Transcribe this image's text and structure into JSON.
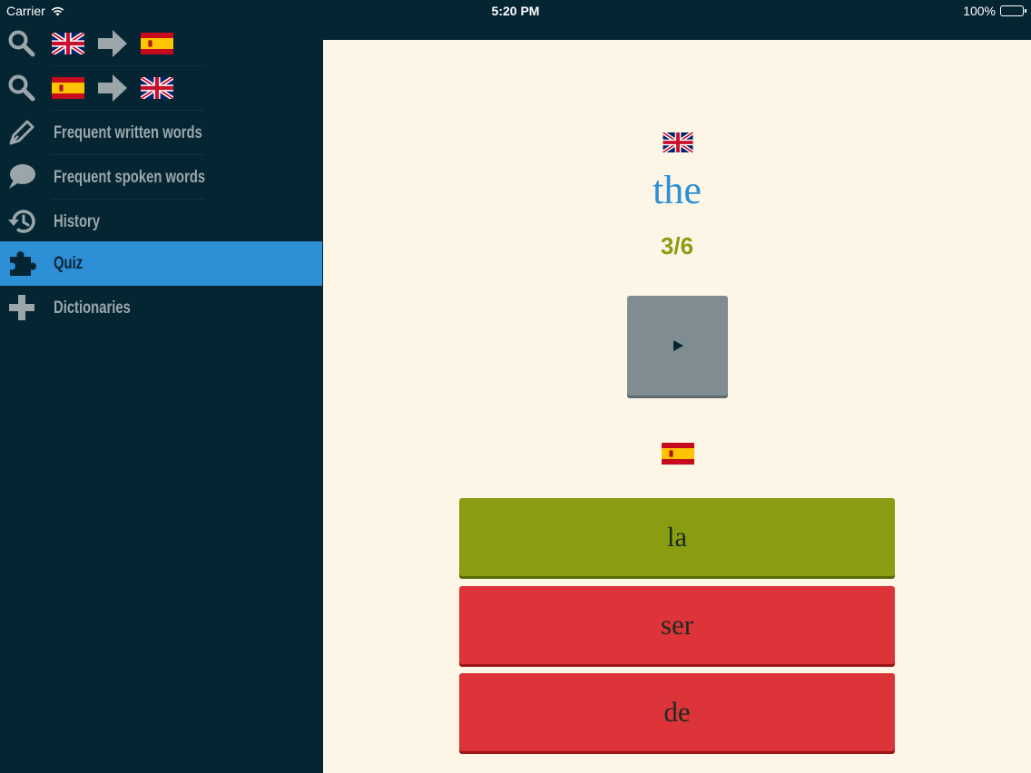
{
  "status_bar": {
    "carrier": "Carrier",
    "time": "5:20 PM",
    "battery": "100%"
  },
  "sidebar": {
    "items": [
      {
        "type": "translate",
        "from": "uk-flag",
        "to": "spain-flag"
      },
      {
        "type": "translate",
        "from": "spain-flag",
        "to": "uk-flag"
      },
      {
        "label": "Frequent written words",
        "icon": "pen-icon"
      },
      {
        "label": "Frequent spoken words",
        "icon": "speech-bubble-icon"
      },
      {
        "label": "History",
        "icon": "history-icon"
      },
      {
        "label": "Quiz",
        "icon": "puzzle-icon",
        "active": true
      },
      {
        "label": "Dictionaries",
        "icon": "plus-icon"
      }
    ]
  },
  "quiz": {
    "question_language": "uk-flag",
    "word": "the",
    "progress": "3/6",
    "answer_language": "spain-flag",
    "answers": [
      {
        "text": "la",
        "state": "correct"
      },
      {
        "text": "ser",
        "state": "wrong"
      },
      {
        "text": "de",
        "state": "wrong"
      }
    ]
  },
  "colors": {
    "sidebar_bg": "#062533",
    "active_item": "#2d8fd6",
    "main_bg": "#fdf5e6",
    "correct": "#8a9d12",
    "wrong": "#dc3438",
    "play_button": "#7f8d93"
  }
}
